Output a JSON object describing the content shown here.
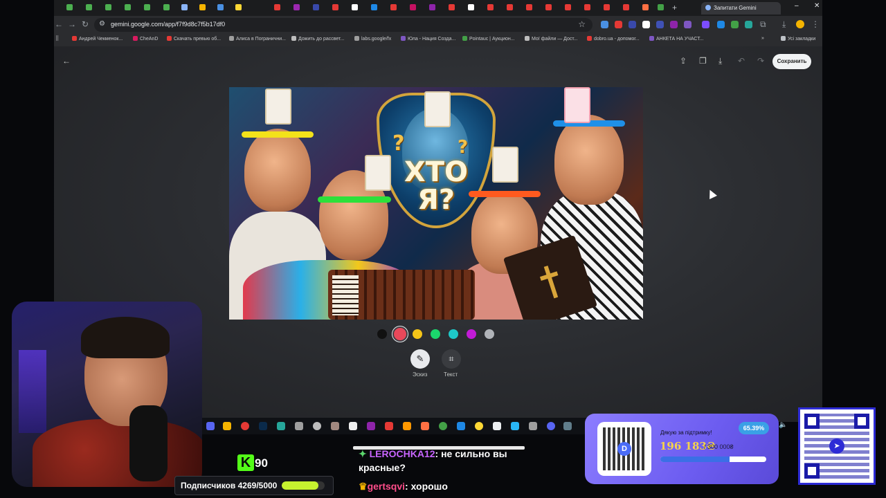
{
  "browser": {
    "active_tab": "Запитати Gemini",
    "url": "gemini.google.com/app/f7f9d8c7f5b17df0",
    "bookmarks": [
      "Андрей Чекменок...",
      "CheAnD",
      "Скачать превью об...",
      "Алиса в Погранични...",
      "Дожить до рассвет...",
      "labs.google/fx",
      "Юла - Нация Созда...",
      "Pointauc | Аукцион...",
      "Мої файли — Дост...",
      "dobro.ua - допомог...",
      "АНКЕТА НА УЧАСТ..."
    ],
    "all_bookmarks": "Усі закладки",
    "colors": {
      "window": "#202124",
      "toolbar": "#2b2c2f",
      "accent": "#8ab4f8"
    }
  },
  "editor": {
    "save_label": "Сохранить",
    "image_title_line1": "ХТО",
    "image_title_line2": "Я?",
    "palette": [
      "#111111",
      "#e8485a",
      "#f5c518",
      "#1bd66c",
      "#1ec8c8",
      "#c21bd6",
      "#b0b3b8"
    ],
    "selected_color": "#e8485a",
    "tools": [
      {
        "label": "Эскиз",
        "icon": "pencil-icon"
      },
      {
        "label": "Текст",
        "icon": "text-box-icon"
      }
    ]
  },
  "stream": {
    "kick_count": "90",
    "subscribers_label": "Подписчиков 4269/5000",
    "subscribers_progress": 0.8538,
    "chat": [
      {
        "user": "LEROCHKA12",
        "text": "не сильно вы красные?"
      },
      {
        "user": "gertsqvi",
        "text": "хорошо"
      }
    ],
    "donation": {
      "thanks": "Дякую за підтримку!",
      "percent": "65.39%",
      "amount": "196 183₴",
      "goal": "/ 300 000₴",
      "progress": 0.6539,
      "colors": {
        "panel": "#7b6cf6",
        "amount": "#f6d34a",
        "bar": "#3b6fe6"
      }
    }
  }
}
